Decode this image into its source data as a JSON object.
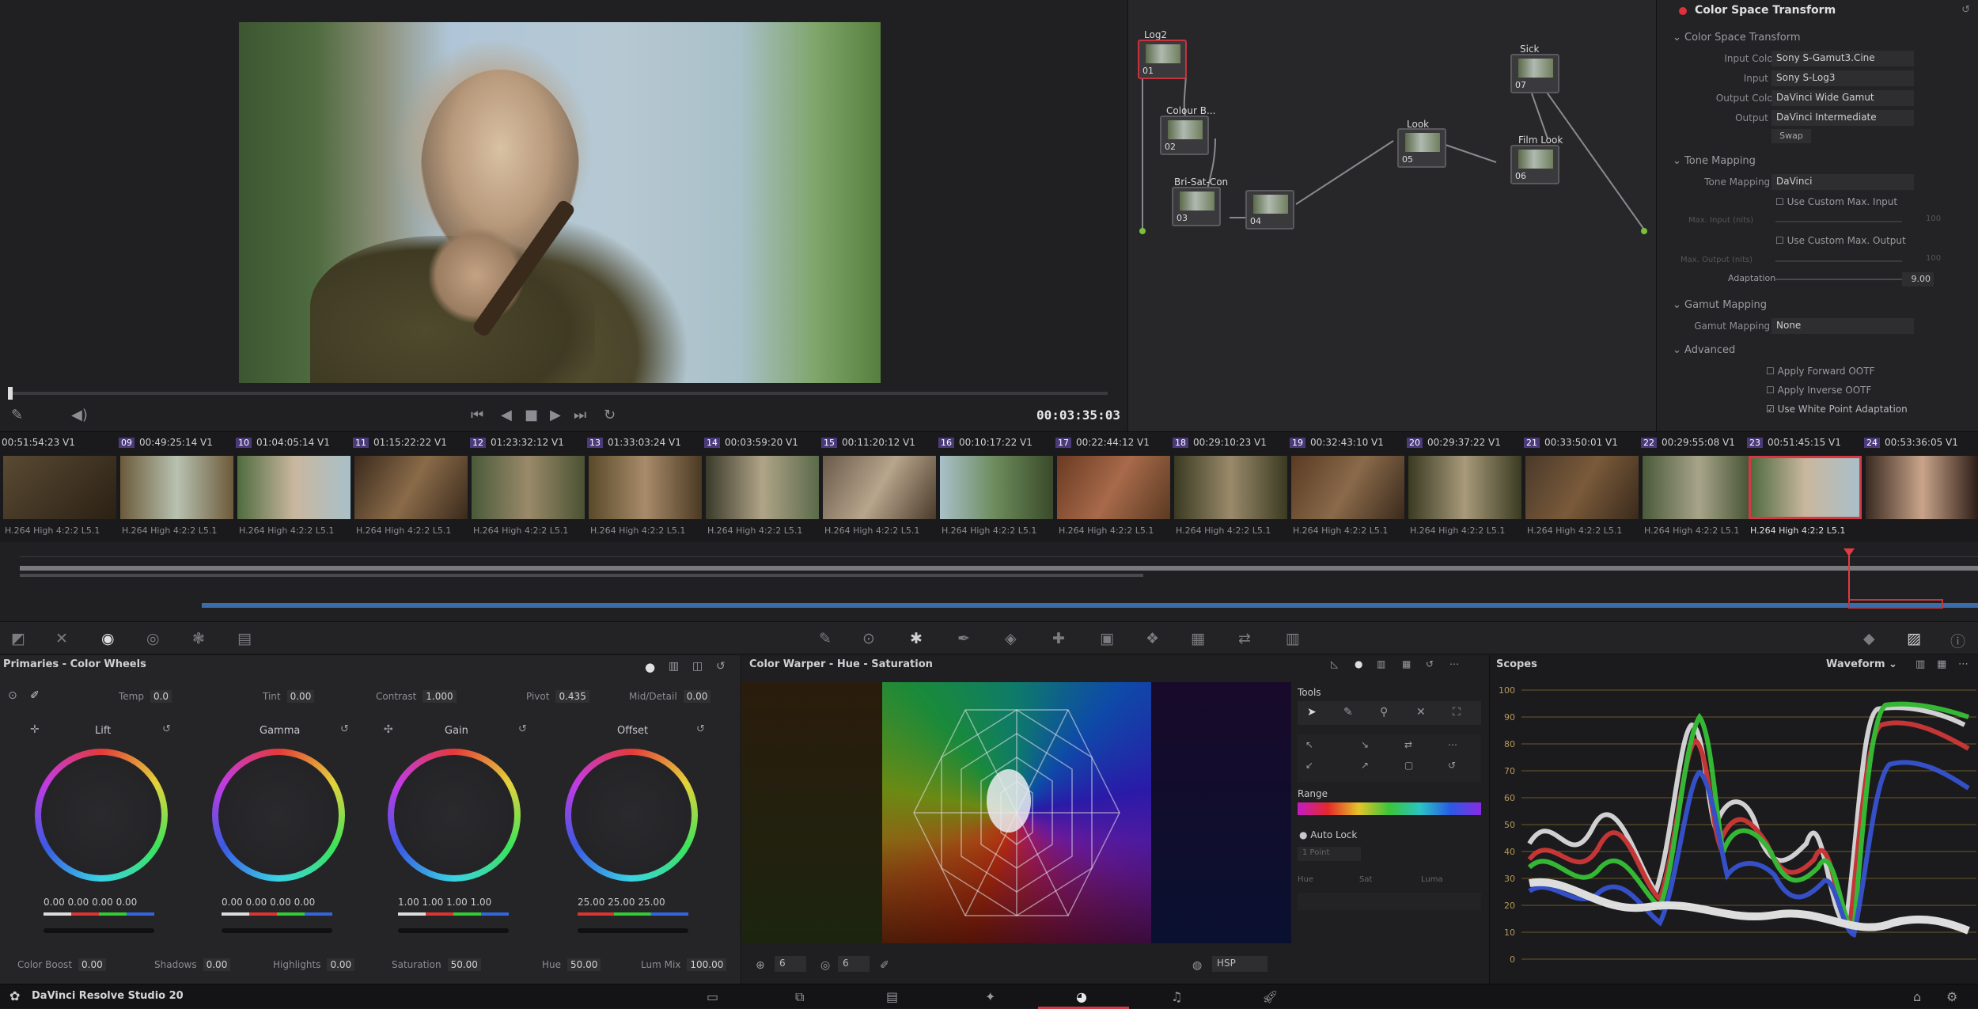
{
  "viewer": {
    "timecode": "00:03:35:03"
  },
  "nodes": [
    {
      "label": "Log2",
      "num": "01"
    },
    {
      "label": "Colour B...",
      "num": "02"
    },
    {
      "label": "Bri-Sat-Con",
      "num": "03"
    },
    {
      "label": "",
      "num": "04"
    },
    {
      "label": "Look",
      "num": "05"
    },
    {
      "label": "Film Look",
      "num": "06"
    },
    {
      "label": "Sick",
      "num": "07"
    }
  ],
  "inspector": {
    "title": "Color Space Transform",
    "section1": "Color Space Transform",
    "rows1": [
      {
        "label": "Input Color Space",
        "value": "Sony S-Gamut3.Cine"
      },
      {
        "label": "Input Gamma",
        "value": "Sony S-Log3"
      },
      {
        "label": "Output Color Space",
        "value": "DaVinci Wide Gamut"
      },
      {
        "label": "Output Gamma",
        "value": "DaVinci Intermediate"
      }
    ],
    "swap": "Swap",
    "section2": "Tone Mapping",
    "tone_method_label": "Tone Mapping Method",
    "tone_method": "DaVinci",
    "custom_input": "Use Custom Max. Input",
    "max_input_label": "Max. Input (nits)",
    "max_input": "100",
    "custom_output": "Use Custom Max. Output",
    "max_output_label": "Max. Output (nits)",
    "max_output": "100",
    "adaptation_label": "Adaptation",
    "adaptation": "9.00",
    "section3": "Gamut Mapping",
    "gamut_label": "Gamut Mapping Method",
    "gamut": "None",
    "section4": "Advanced",
    "adv1": "Apply Forward OOTF",
    "adv2": "Apply Inverse OOTF",
    "adv3": "Use White Point Adaptation"
  },
  "clips": [
    {
      "num": "",
      "tc": "00:51:54:23",
      "track": "V1",
      "codec": "H.264 High 4:2:2 L5.1"
    },
    {
      "num": "09",
      "tc": "00:49:25:14",
      "track": "V1",
      "codec": "H.264 High 4:2:2 L5.1"
    },
    {
      "num": "10",
      "tc": "01:04:05:14",
      "track": "V1",
      "codec": "H.264 High 4:2:2 L5.1"
    },
    {
      "num": "11",
      "tc": "01:15:22:22",
      "track": "V1",
      "codec": "H.264 High 4:2:2 L5.1"
    },
    {
      "num": "12",
      "tc": "01:23:32:12",
      "track": "V1",
      "codec": "H.264 High 4:2:2 L5.1"
    },
    {
      "num": "13",
      "tc": "01:33:03:24",
      "track": "V1",
      "codec": "H.264 High 4:2:2 L5.1"
    },
    {
      "num": "14",
      "tc": "00:03:59:20",
      "track": "V1",
      "codec": "H.264 High 4:2:2 L5.1"
    },
    {
      "num": "15",
      "tc": "00:11:20:12",
      "track": "V1",
      "codec": "H.264 High 4:2:2 L5.1"
    },
    {
      "num": "16",
      "tc": "00:10:17:22",
      "track": "V1",
      "codec": "H.264 High 4:2:2 L5.1"
    },
    {
      "num": "17",
      "tc": "00:22:44:12",
      "track": "V1",
      "codec": "H.264 High 4:2:2 L5.1"
    },
    {
      "num": "18",
      "tc": "00:29:10:23",
      "track": "V1",
      "codec": "H.264 High 4:2:2 L5.1"
    },
    {
      "num": "19",
      "tc": "00:32:43:10",
      "track": "V1",
      "codec": "H.264 High 4:2:2 L5.1"
    },
    {
      "num": "20",
      "tc": "00:29:37:22",
      "track": "V1",
      "codec": "H.264 High 4:2:2 L5.1"
    },
    {
      "num": "21",
      "tc": "00:33:50:01",
      "track": "V1",
      "codec": "H.264 High 4:2:2 L5.1"
    },
    {
      "num": "22",
      "tc": "00:29:55:08",
      "track": "V1",
      "codec": "H.264 High 4:2:2 L5.1"
    },
    {
      "num": "23",
      "tc": "00:51:45:15",
      "track": "V1",
      "codec": "H.264 High 4:2:2 L5.1"
    },
    {
      "num": "24",
      "tc": "00:53:36:05",
      "track": "V1",
      "codec": "H.264 High 4:2:2 L5.1"
    }
  ],
  "primaries": {
    "title": "Primaries - Color Wheels",
    "temp_label": "Temp",
    "temp": "0.0",
    "tint_label": "Tint",
    "tint": "0.00",
    "contrast_label": "Contrast",
    "contrast": "1.000",
    "pivot_label": "Pivot",
    "pivot": "0.435",
    "middetail_label": "Mid/Detail",
    "middetail": "0.00",
    "wheels": [
      {
        "name": "Lift",
        "values": "0.00   0.00   0.00   0.00"
      },
      {
        "name": "Gamma",
        "values": "0.00   0.00   0.00   0.00"
      },
      {
        "name": "Gain",
        "values": "1.00   1.00   1.00   1.00"
      },
      {
        "name": "Offset",
        "values": "25.00   25.00   25.00"
      }
    ],
    "colorboost_label": "Color Boost",
    "colorboost": "0.00",
    "shadows_label": "Shadows",
    "shadows": "0.00",
    "highlights_label": "Highlights",
    "highlights": "0.00",
    "saturation_label": "Saturation",
    "saturation": "50.00",
    "hue_label": "Hue",
    "hue": "50.00",
    "lummix_label": "Lum Mix",
    "lummix": "100.00"
  },
  "warper": {
    "title": "Color Warper - Hue - Saturation",
    "sel1": "6",
    "sel2": "6",
    "mode": "HSP"
  },
  "tools": {
    "label": "Tools",
    "range": "Range",
    "autolock": "Auto Lock",
    "point": "1 Point",
    "hue": "Hue",
    "sat": "Sat",
    "luma": "Luma"
  },
  "scopes": {
    "title": "Scopes",
    "mode": "Waveform",
    "scale": [
      "100",
      "90",
      "80",
      "70",
      "60",
      "50",
      "40",
      "30",
      "20",
      "10",
      "0"
    ]
  },
  "status": {
    "app": "DaVinci Resolve Studio 20"
  }
}
